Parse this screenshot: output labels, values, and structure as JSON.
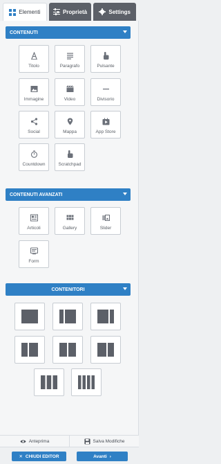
{
  "tabs": [
    {
      "label": "Elementi",
      "icon": "grid-icon"
    },
    {
      "label": "Proprietà",
      "icon": "sliders-icon"
    },
    {
      "label": "Settings",
      "icon": "gear-icon"
    }
  ],
  "sections": {
    "contenuti": {
      "title": "CONTENUTI"
    },
    "avanzati": {
      "title": "CONTENUTI AVANZATI"
    },
    "contenitori": {
      "title": "CONTENITORI"
    }
  },
  "contenuti_items": [
    {
      "label": "Titolo",
      "icon": "heading-icon"
    },
    {
      "label": "Paragrafo",
      "icon": "paragraph-icon"
    },
    {
      "label": "Pulsante",
      "icon": "button-pointer-icon"
    },
    {
      "label": "Immagine",
      "icon": "image-icon"
    },
    {
      "label": "Video",
      "icon": "video-icon"
    },
    {
      "label": "Divisorio",
      "icon": "divider-icon"
    },
    {
      "label": "Social",
      "icon": "share-icon"
    },
    {
      "label": "Mappa",
      "icon": "map-pin-icon"
    },
    {
      "label": "App Store",
      "icon": "app-store-icon"
    },
    {
      "label": "Countdown",
      "icon": "stopwatch-icon"
    },
    {
      "label": "Scratchpad",
      "icon": "scratchpad-icon"
    }
  ],
  "avanzati_items": [
    {
      "label": "Articoli",
      "icon": "articles-icon"
    },
    {
      "label": "Gallery",
      "icon": "gallery-icon"
    },
    {
      "label": "Slider",
      "icon": "slider-icon"
    },
    {
      "label": "Form",
      "icon": "form-icon"
    }
  ],
  "containers": [
    {
      "name": "layout-1-col"
    },
    {
      "name": "layout-sidebar-left"
    },
    {
      "name": "layout-sidebar-right"
    },
    {
      "name": "layout-2-col-wide-left"
    },
    {
      "name": "layout-2-col-equal"
    },
    {
      "name": "layout-2-col-wide-right"
    },
    {
      "name": "layout-3-col"
    },
    {
      "name": "layout-4-col"
    }
  ],
  "footer": {
    "preview": "Anteprima",
    "save": "Salva Modifiche"
  },
  "actions": {
    "close": "CHIUDI EDITOR",
    "next": "Avanti"
  },
  "colors": {
    "accent": "#2f80c5",
    "dark_tab": "#5c6068",
    "icon": "#6b7079"
  }
}
